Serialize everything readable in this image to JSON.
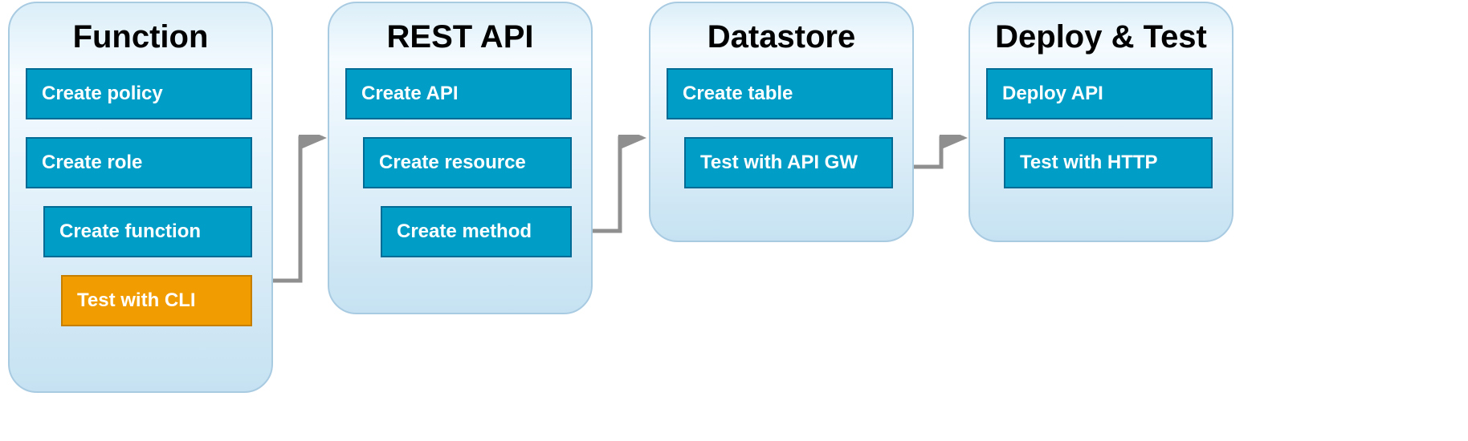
{
  "stages": [
    {
      "title": "Function",
      "steps": [
        {
          "label": "Create policy",
          "indent": 0,
          "color": "teal"
        },
        {
          "label": "Create role",
          "indent": 0,
          "color": "teal"
        },
        {
          "label": "Create function",
          "indent": 1,
          "color": "teal"
        },
        {
          "label": "Test with CLI",
          "indent": 2,
          "color": "orange"
        }
      ]
    },
    {
      "title": "REST API",
      "steps": [
        {
          "label": "Create API",
          "indent": 0,
          "color": "teal"
        },
        {
          "label": "Create resource",
          "indent": 1,
          "color": "teal"
        },
        {
          "label": "Create method",
          "indent": 2,
          "color": "teal"
        }
      ]
    },
    {
      "title": "Datastore",
      "steps": [
        {
          "label": "Create table",
          "indent": 0,
          "color": "teal"
        },
        {
          "label": "Test with API GW",
          "indent": 1,
          "color": "teal"
        }
      ]
    },
    {
      "title": "Deploy & Test",
      "steps": [
        {
          "label": "Deploy API",
          "indent": 0,
          "color": "teal"
        },
        {
          "label": "Test with HTTP",
          "indent": 1,
          "color": "teal"
        }
      ]
    }
  ]
}
